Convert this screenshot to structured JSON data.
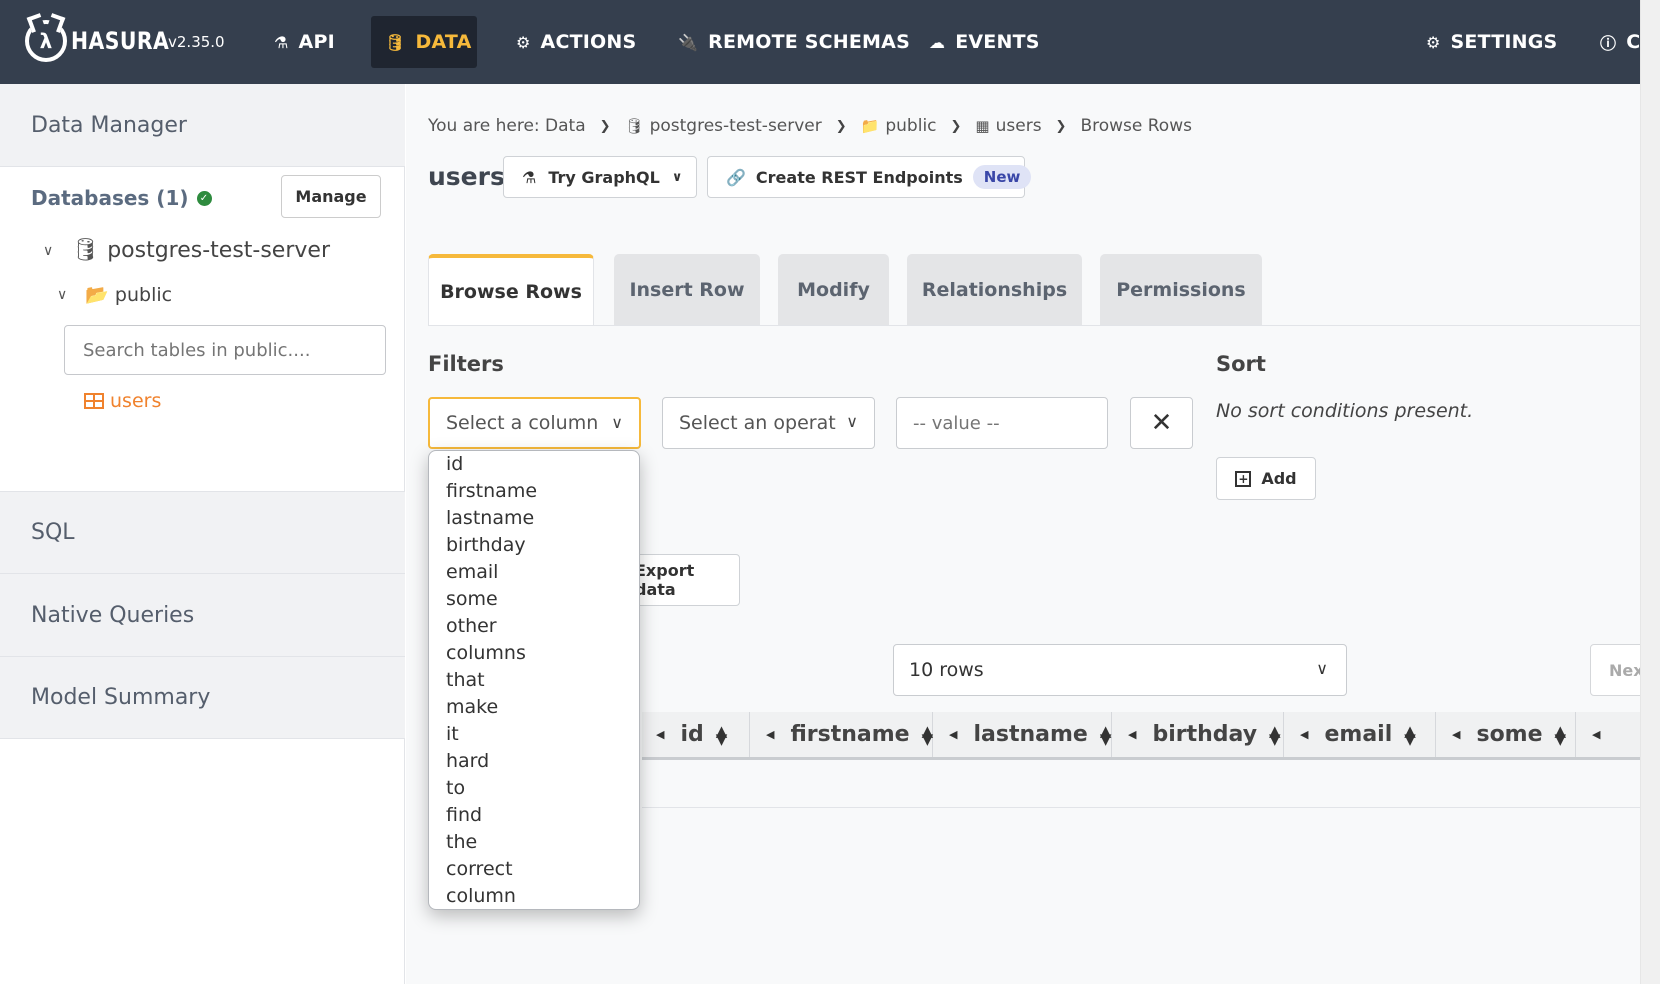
{
  "nav": {
    "logo_text": "HASURA",
    "version": "v2.35.0",
    "items": [
      {
        "label": "API",
        "icon": "flask-icon"
      },
      {
        "label": "DATA",
        "icon": "database-icon"
      },
      {
        "label": "ACTIONS",
        "icon": "gears-icon"
      },
      {
        "label": "REMOTE SCHEMAS",
        "icon": "plug-icon"
      },
      {
        "label": "EVENTS",
        "icon": "cloud-icon"
      }
    ],
    "settings_label": "SETTINGS",
    "info_label": "C",
    "active_color": "#f6b93b"
  },
  "sidebar": {
    "data_manager": "Data Manager",
    "databases_label": "Databases (1)",
    "manage_label": "Manage",
    "server_name": "postgres-test-server",
    "schema_name": "public",
    "search_placeholder": "Search tables in public....",
    "table_name": "users",
    "sections": [
      "SQL",
      "Native Queries",
      "Model Summary"
    ]
  },
  "breadcrumb": {
    "prefix": "You are here:",
    "items": [
      "Data",
      "postgres-test-server",
      "public",
      "users",
      "Browse Rows"
    ]
  },
  "header": {
    "title": "users",
    "try_graphql": "Try GraphQL",
    "create_rest": "Create REST Endpoints",
    "new_badge": "New"
  },
  "tabs": [
    "Browse Rows",
    "Insert Row",
    "Modify",
    "Relationships",
    "Permissions"
  ],
  "filters": {
    "label": "Filters",
    "column_placeholder": "Select a column",
    "operator_placeholder": "Select an operat",
    "value_placeholder": "-- value --"
  },
  "sort": {
    "label": "Sort",
    "empty_text": "No sort conditions present.",
    "add_label": "Add"
  },
  "export_label": "Export data",
  "rows_select": "10 rows",
  "next_label": "Next",
  "table": {
    "columns": [
      "id",
      "firstname",
      "lastname",
      "birthday",
      "email",
      "some"
    ]
  },
  "dropdown": {
    "options": [
      "id",
      "firstname",
      "lastname",
      "birthday",
      "email",
      "some",
      "other",
      "columns",
      "that",
      "make",
      "it",
      "hard",
      "to",
      "find",
      "the",
      "correct",
      "column"
    ]
  }
}
